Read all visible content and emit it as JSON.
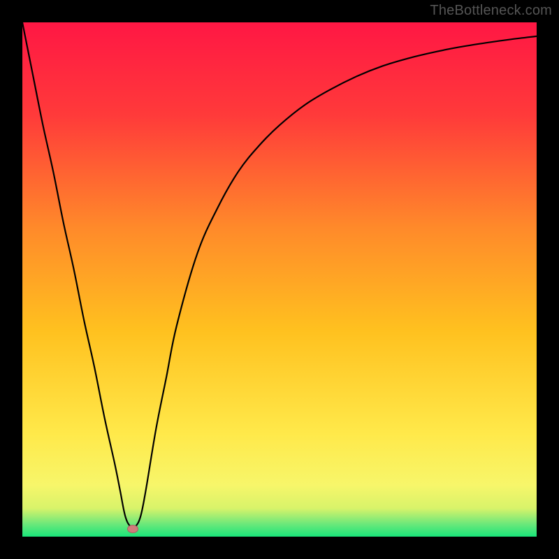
{
  "watermark": {
    "text": "TheBottleneck.com"
  },
  "chart_data": {
    "type": "line",
    "title": "",
    "xlabel": "",
    "ylabel": "",
    "xlim": [
      0,
      100
    ],
    "ylim": [
      0,
      100
    ],
    "grid": false,
    "legend": false,
    "gradient_stops": [
      {
        "offset": 0.0,
        "color": "#ff1744"
      },
      {
        "offset": 0.18,
        "color": "#ff3a3a"
      },
      {
        "offset": 0.4,
        "color": "#ff8a2a"
      },
      {
        "offset": 0.6,
        "color": "#ffc11f"
      },
      {
        "offset": 0.8,
        "color": "#ffe94a"
      },
      {
        "offset": 0.9,
        "color": "#f7f66a"
      },
      {
        "offset": 0.945,
        "color": "#d8f36a"
      },
      {
        "offset": 0.975,
        "color": "#6de87a"
      },
      {
        "offset": 1.0,
        "color": "#19e57a"
      }
    ],
    "series": [
      {
        "name": "bottleneck-curve",
        "color": "#000000",
        "x": [
          0,
          2,
          4,
          6,
          8,
          10,
          12,
          14,
          16,
          18,
          19,
          20,
          21,
          22,
          23,
          24,
          26,
          28,
          30,
          34,
          38,
          42,
          46,
          50,
          55,
          60,
          65,
          70,
          75,
          80,
          85,
          90,
          95,
          100
        ],
        "y": [
          100,
          90,
          80,
          71,
          61,
          52,
          42,
          33,
          23,
          14,
          9,
          4,
          2,
          2,
          4,
          9,
          21,
          31,
          41,
          55,
          64,
          71,
          76,
          80,
          84,
          87,
          89.5,
          91.5,
          93,
          94.2,
          95.2,
          96,
          96.7,
          97.3
        ]
      }
    ],
    "marker": {
      "x": 21.5,
      "y": 1.5,
      "color": "#cf7d7b"
    }
  }
}
